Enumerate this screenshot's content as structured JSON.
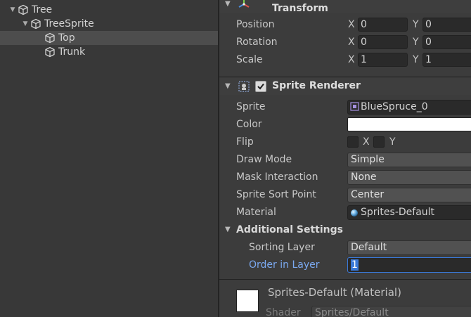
{
  "hierarchy": {
    "items": [
      {
        "label": "Tree",
        "expanded": true
      },
      {
        "label": "TreeSprite",
        "expanded": true
      },
      {
        "label": "Top",
        "selected": true
      },
      {
        "label": "Trunk"
      }
    ]
  },
  "inspector": {
    "transform": {
      "title": "Transform",
      "rows": [
        {
          "label": "Position",
          "x_axis": "X",
          "x": "0",
          "y_axis": "Y",
          "y": "0"
        },
        {
          "label": "Rotation",
          "x_axis": "X",
          "x": "0",
          "y_axis": "Y",
          "y": "0"
        },
        {
          "label": "Scale",
          "x_axis": "X",
          "x": "1",
          "y_axis": "Y",
          "y": "1"
        }
      ]
    },
    "sprite_renderer": {
      "title": "Sprite Renderer",
      "enabled": true,
      "sprite_label": "Sprite",
      "sprite_value": "BlueSpruce_0",
      "color_label": "Color",
      "color_value": "#ffffff",
      "flip_label": "Flip",
      "flip_x": "X",
      "flip_y": "Y",
      "draw_mode_label": "Draw Mode",
      "draw_mode_value": "Simple",
      "mask_label": "Mask Interaction",
      "mask_value": "None",
      "sort_point_label": "Sprite Sort Point",
      "sort_point_value": "Center",
      "material_label": "Material",
      "material_value": "Sprites-Default",
      "additional_title": "Additional Settings",
      "sorting_layer_label": "Sorting Layer",
      "sorting_layer_value": "Default",
      "order_label": "Order in Layer",
      "order_value": "1"
    },
    "material_section": {
      "title": "Sprites-Default (Material)",
      "shader_label": "Shader",
      "shader_value": "Sprites/Default"
    }
  },
  "colors": {
    "panel_bg": "#383838",
    "inspector_bg": "#3c3c3c",
    "field_bg": "#2a2a2a",
    "dropdown_bg": "#515151",
    "accent_label": "#7ba9f0",
    "focus_border": "#3a79d8"
  }
}
